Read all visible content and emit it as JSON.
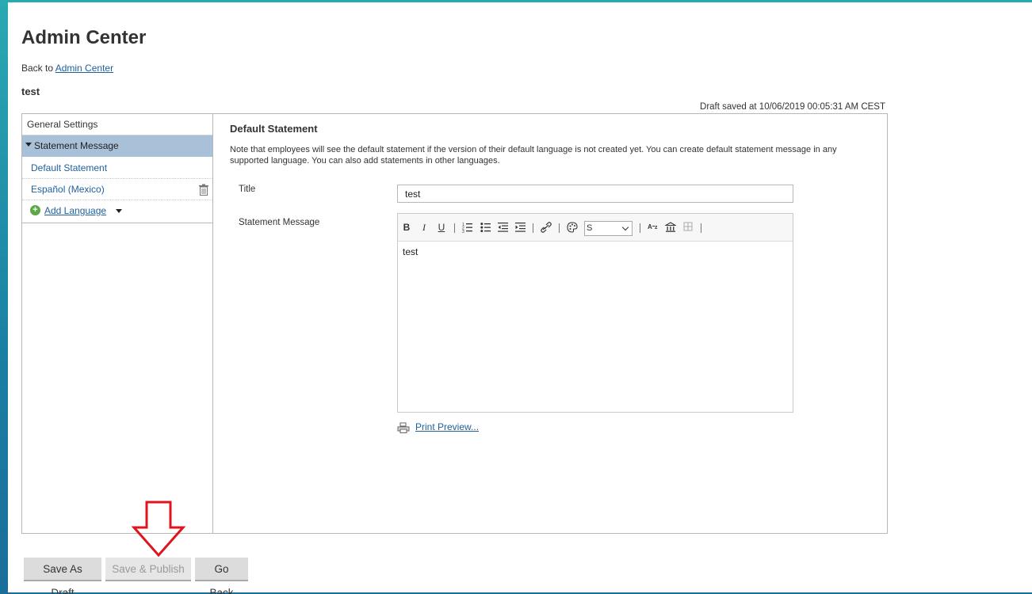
{
  "header": {
    "title": "Admin Center",
    "back_prefix": "Back to",
    "back_link": "Admin Center",
    "subtitle": "test",
    "draft_status": "Draft saved at 10/06/2019 00:05:31 AM CEST"
  },
  "sidebar": {
    "general_settings": "General Settings",
    "statement_message": "Statement Message",
    "items": [
      {
        "label": "Default Statement"
      },
      {
        "label": "Español (Mexico)"
      }
    ],
    "add_language": "Add Language"
  },
  "main": {
    "section_title": "Default Statement",
    "note": "Note that employees will see the default statement if the version of their default language is not created yet. You can create default statement message in any supported language. You can also add statements in other languages.",
    "title_label": "Title",
    "title_value": "test",
    "message_label": "Statement Message",
    "editor": {
      "bold": "B",
      "italic": "I",
      "underline": "U",
      "font_size_value": "S",
      "body_text": "test"
    },
    "print_preview": "Print Preview..."
  },
  "footer": {
    "save_draft": "Save As Draft",
    "save_publish": "Save & Publish",
    "go_back": "Go Back"
  },
  "colors": {
    "accent_link": "#1f5f9c",
    "selected_row": "#a8c1d9",
    "annotation_arrow": "#e0141e"
  }
}
